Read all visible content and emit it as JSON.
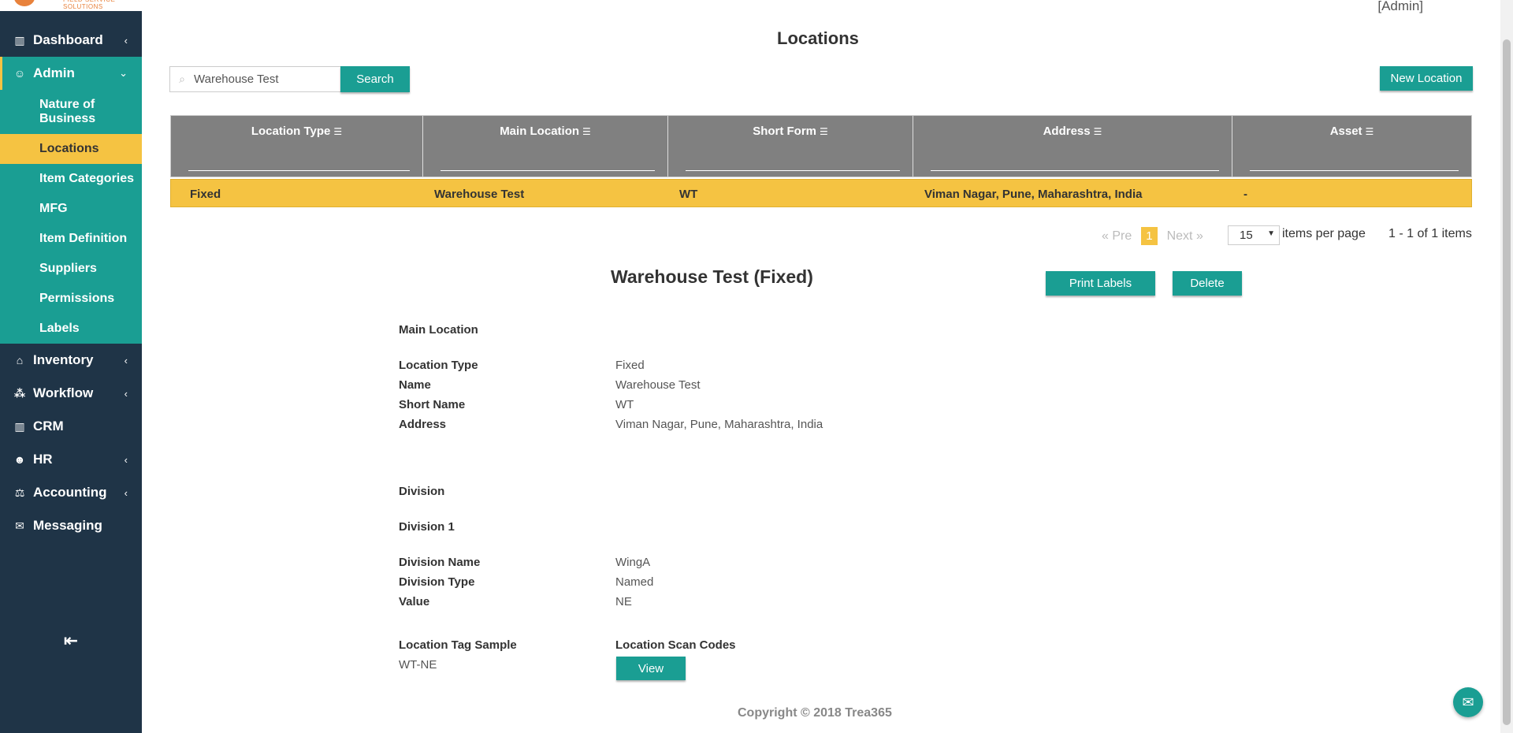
{
  "brand": {
    "tagline": "FIELD SERVICE SOLUTIONS"
  },
  "header": {
    "user_role": "[Admin]",
    "page_title": "Locations"
  },
  "sidebar": {
    "items": [
      {
        "label": "Dashboard",
        "icon": "bar-chart-icon",
        "chevron": "‹"
      },
      {
        "label": "Admin",
        "icon": "user-icon",
        "chevron": "⌄"
      },
      {
        "label": "Inventory",
        "icon": "home-icon",
        "chevron": "‹"
      },
      {
        "label": "Workflow",
        "icon": "workflow-icon",
        "chevron": "‹"
      },
      {
        "label": "CRM",
        "icon": "bar-chart-icon",
        "chevron": ""
      },
      {
        "label": "HR",
        "icon": "people-icon",
        "chevron": "‹"
      },
      {
        "label": "Accounting",
        "icon": "scale-icon",
        "chevron": "‹"
      },
      {
        "label": "Messaging",
        "icon": "chat-icon",
        "chevron": ""
      }
    ],
    "admin_subitems": [
      "Nature of Business",
      "Locations",
      "Item Categories",
      "MFG",
      "Item Definition",
      "Suppliers",
      "Permissions",
      "Labels"
    ],
    "active_subitem": "Locations",
    "collapse_icon": "collapse-left-icon"
  },
  "search": {
    "value": "Warehouse Test",
    "placeholder": "",
    "button_label": "Search"
  },
  "new_location_label": "New Location",
  "grid": {
    "columns": [
      "Location Type",
      "Main Location",
      "Short Form",
      "Address",
      "Asset"
    ],
    "rows": [
      [
        "Fixed",
        "Warehouse Test",
        "WT",
        "Viman Nagar, Pune, Maharashtra, India",
        "-"
      ]
    ]
  },
  "pager": {
    "prev": "« Pre",
    "page": "1",
    "next": "Next »",
    "per_page": "15",
    "per_page_label": "items per page",
    "summary": "1 - 1 of 1 items"
  },
  "detail": {
    "title": "Warehouse Test (Fixed)",
    "print_label": "Print Labels",
    "delete_label": "Delete",
    "main_location_heading": "Main Location",
    "fields": [
      {
        "label": "Location Type",
        "value": "Fixed"
      },
      {
        "label": "Name",
        "value": "Warehouse Test"
      },
      {
        "label": "Short Name",
        "value": "WT"
      },
      {
        "label": "Address",
        "value": "Viman Nagar, Pune, Maharashtra, India"
      }
    ],
    "division_heading": "Division",
    "division_sub_heading": "Division 1",
    "division_fields": [
      {
        "label": "Division Name",
        "value": "WingA"
      },
      {
        "label": "Division Type",
        "value": "Named"
      },
      {
        "label": "Value",
        "value": "NE"
      }
    ],
    "tag_sample_label": "Location Tag Sample",
    "tag_sample_value": "WT-NE",
    "scan_codes_label": "Location Scan Codes",
    "view_label": "View"
  },
  "footer": {
    "copyright": "Copyright © 2018 Trea365"
  },
  "colors": {
    "sidebar_bg": "#1f3447",
    "accent_teal": "#1a9e93",
    "highlight_yellow": "#f5c342",
    "grid_header": "#808080"
  }
}
